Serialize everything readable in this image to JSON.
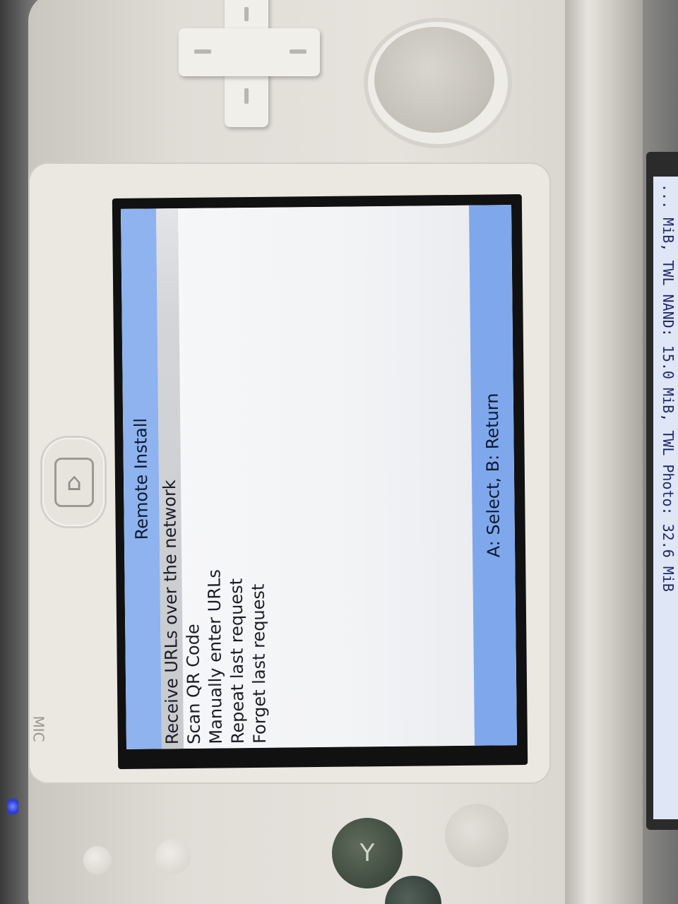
{
  "app": {
    "title": "Remote Install"
  },
  "menu": {
    "items": [
      {
        "label": "Receive URLs over the network",
        "selected": true
      },
      {
        "label": "Scan QR Code",
        "selected": false
      },
      {
        "label": "Manually enter URLs",
        "selected": false
      },
      {
        "label": "Repeat last request",
        "selected": false
      },
      {
        "label": "Forget last request",
        "selected": false
      }
    ]
  },
  "footer": {
    "hint": "A: Select, B: Return"
  },
  "top_screen": {
    "status_text": "... MiB, TWL NAND: 15.0 MiB, TWL Photo: 32.6 MiB"
  },
  "device": {
    "mic_label": "MIC",
    "y_button_label": "Y",
    "home_icon": "home-icon"
  },
  "colors": {
    "header_bar": "#8eb3ee",
    "footer_bar": "#7fa8ec",
    "selection_highlight": "#c7c9cd",
    "led": "#2b3bd8"
  }
}
